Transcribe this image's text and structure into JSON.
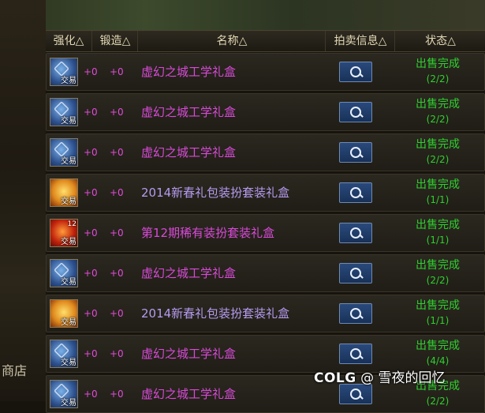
{
  "sidebar": {
    "partial_text": "商店"
  },
  "header": {
    "enhance": "强化△",
    "forge": "锻造△",
    "name": "名称△",
    "auction_info": "拍卖信息△",
    "status": "状态△"
  },
  "rows": [
    {
      "icon": "blue-rune-box-icon",
      "trade_label": "交易",
      "enhance": "+0",
      "forge": "+0",
      "name": "虚幻之城工学礼盒",
      "name_color": "#d84ad8",
      "status": "出售完成",
      "qty": "(2/2)"
    },
    {
      "icon": "blue-rune-box-icon",
      "trade_label": "交易",
      "enhance": "+0",
      "forge": "+0",
      "name": "虚幻之城工学礼盒",
      "name_color": "#d84ad8",
      "status": "出售完成",
      "qty": "(2/2)"
    },
    {
      "icon": "blue-rune-box-icon",
      "trade_label": "交易",
      "enhance": "+0",
      "forge": "+0",
      "name": "虚幻之城工学礼盒",
      "name_color": "#d84ad8",
      "status": "出售完成",
      "qty": "(2/2)"
    },
    {
      "icon": "gold-gift-box-icon",
      "trade_label": "交易",
      "enhance": "+0",
      "forge": "+0",
      "name": "2014新春礼包装扮套装礼盒",
      "name_color": "#b59bf0",
      "status": "出售完成",
      "qty": "(1/1)"
    },
    {
      "icon": "red-gift-box-icon",
      "trade_label": "交易",
      "badge": "12",
      "enhance": "+0",
      "forge": "+0",
      "name": "第12期稀有装扮套装礼盒",
      "name_color": "#d84ad8",
      "status": "出售完成",
      "qty": "(1/1)"
    },
    {
      "icon": "blue-rune-box-icon",
      "trade_label": "交易",
      "enhance": "+0",
      "forge": "+0",
      "name": "虚幻之城工学礼盒",
      "name_color": "#d84ad8",
      "status": "出售完成",
      "qty": "(2/2)"
    },
    {
      "icon": "gold-gift-box-icon",
      "trade_label": "交易",
      "enhance": "+0",
      "forge": "+0",
      "name": "2014新春礼包装扮套装礼盒",
      "name_color": "#b59bf0",
      "status": "出售完成",
      "qty": "(1/1)"
    },
    {
      "icon": "blue-rune-box-icon",
      "trade_label": "交易",
      "enhance": "+0",
      "forge": "+0",
      "name": "虚幻之城工学礼盒",
      "name_color": "#d84ad8",
      "status": "出售完成",
      "qty": "(4/4)"
    },
    {
      "icon": "blue-rune-box-icon",
      "trade_label": "交易",
      "enhance": "+0",
      "forge": "+0",
      "name": "虚幻之城工学礼盒",
      "name_color": "#d84ad8",
      "status": "出售完成",
      "qty": "(2/2)"
    }
  ],
  "watermark": {
    "brand": "COLG",
    "author": "@ 雪夜的回忆"
  },
  "colors": {
    "status_green": "#2fd02f",
    "enhance_magenta": "#e04bd8",
    "search_button_blue": "#183158"
  }
}
